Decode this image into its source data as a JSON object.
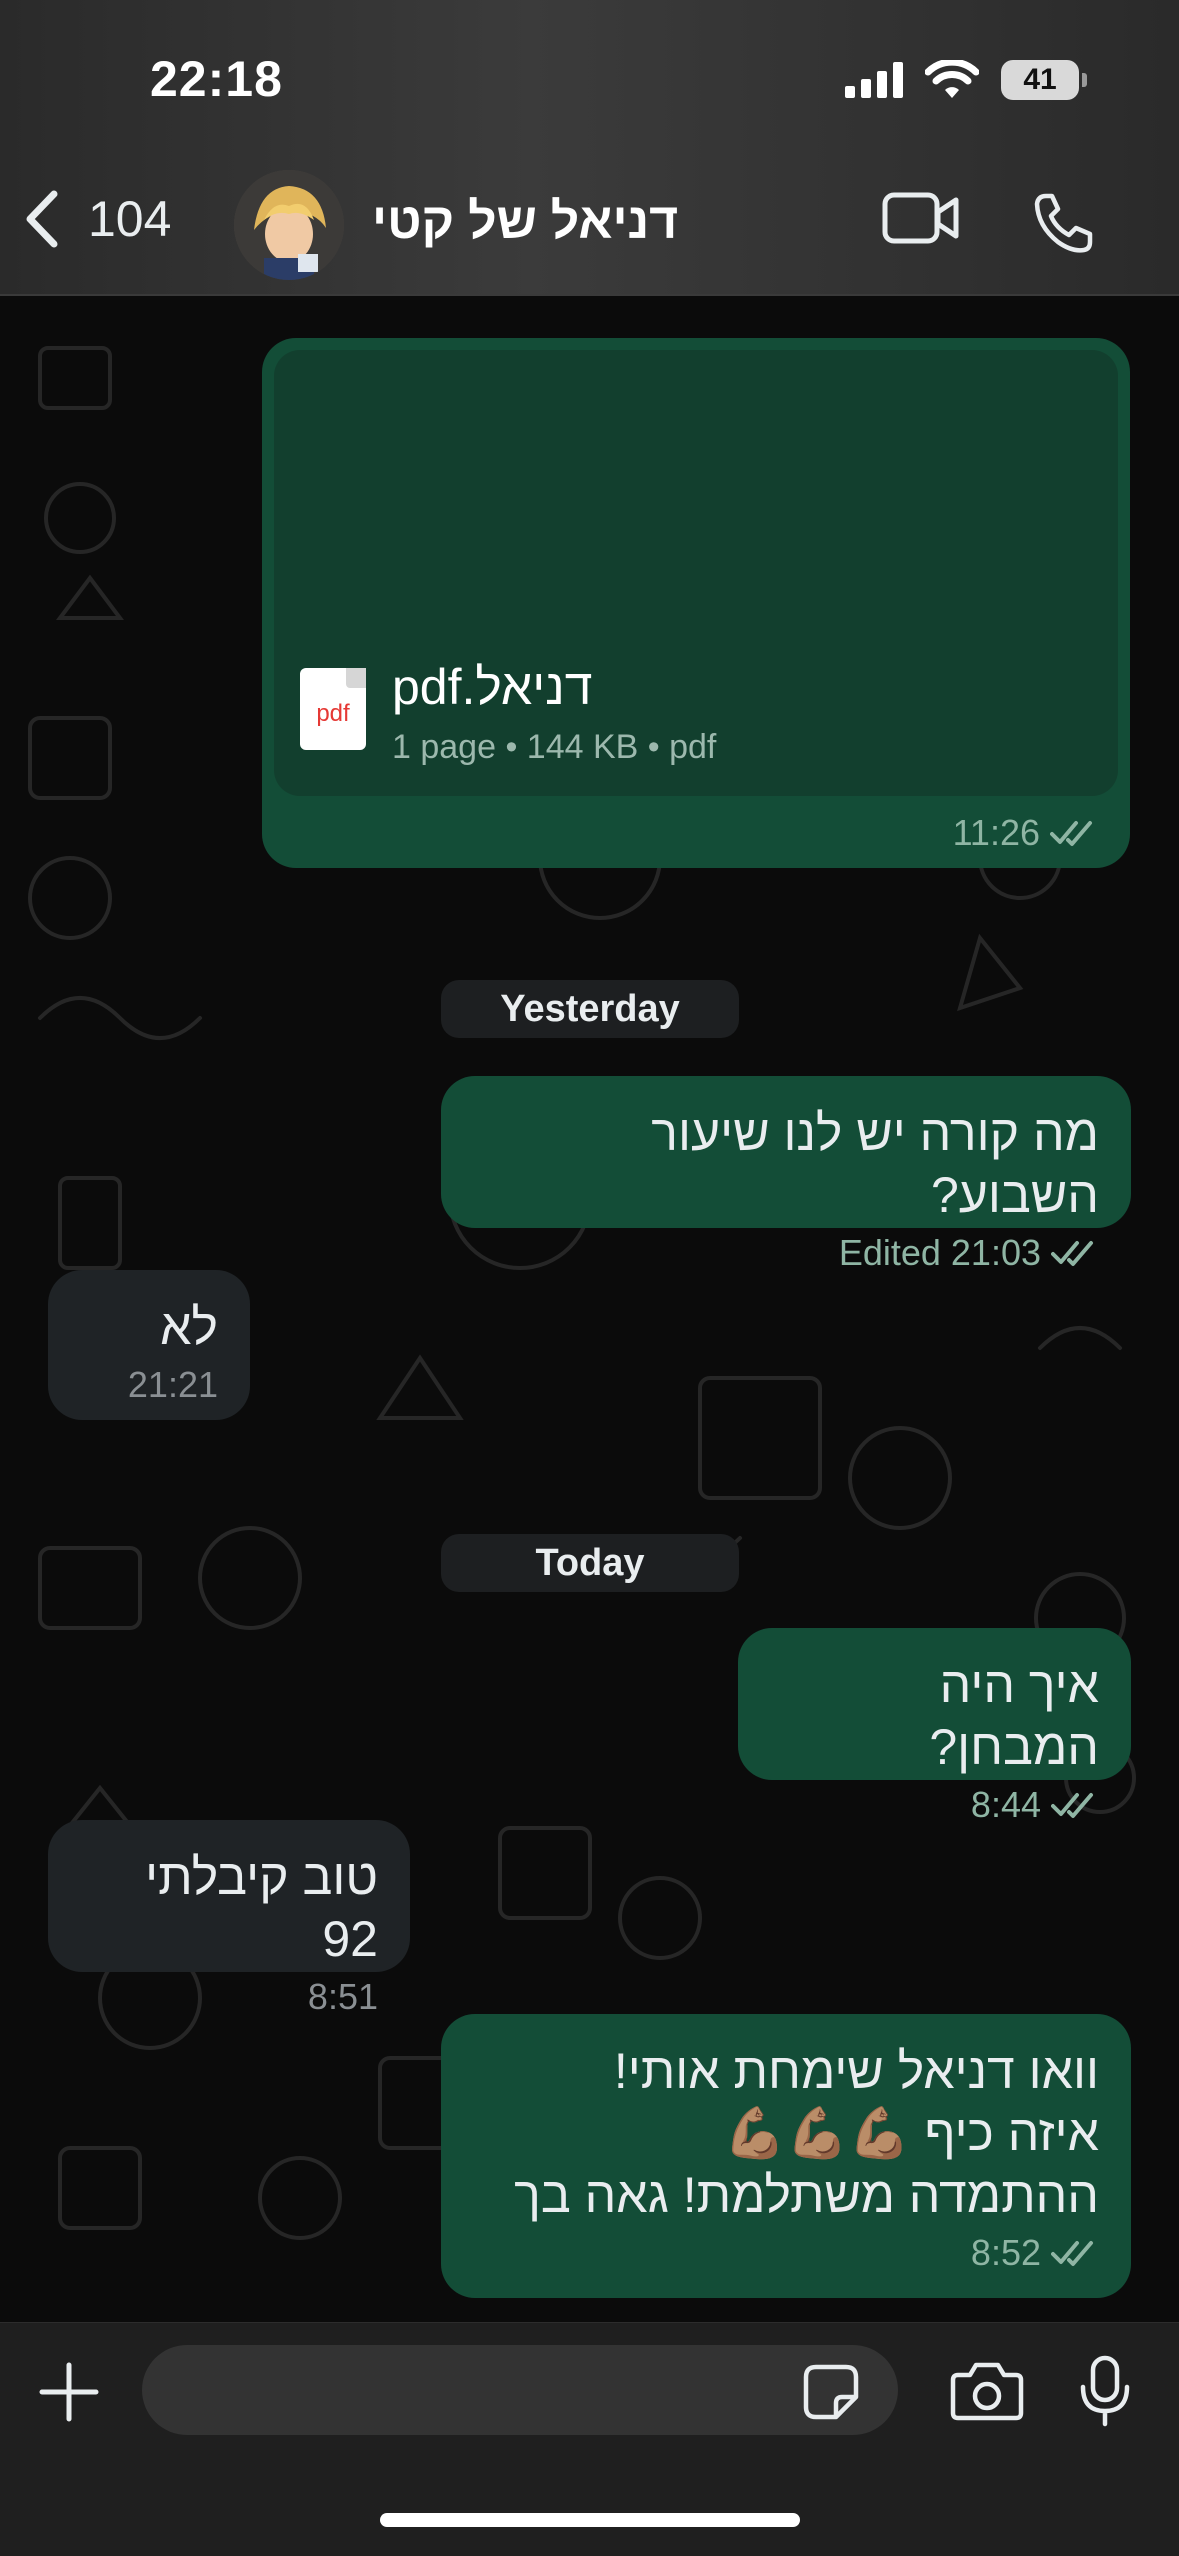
{
  "status_bar": {
    "time": "22:18",
    "battery": "41",
    "icons": [
      "cellular-signal-icon",
      "wifi-icon",
      "battery-icon"
    ]
  },
  "header": {
    "back_count": "104",
    "contact_name": "דניאל של קטי",
    "icons": [
      "chevron-left-icon",
      "video-call-icon",
      "phone-icon"
    ]
  },
  "messages": {
    "pdf": {
      "file_name": "pdf.דניאל",
      "file_badge": "pdf",
      "info": "1 page • 144 KB • pdf",
      "time": "11:26"
    },
    "date_yesterday": "Yesterday",
    "m1": {
      "text": "מה קורה יש לנו שיעור השבוע?",
      "edited": "Edited",
      "time": "21:03"
    },
    "m2": {
      "text": "לא",
      "time": "21:21"
    },
    "date_today": "Today",
    "m3": {
      "text": "איך היה המבחן?",
      "time": "8:44"
    },
    "m4": {
      "text": "טוב קיבלתי 92",
      "time": "8:51"
    },
    "m5": {
      "line1": "וואו דניאל שימחת אותי!",
      "line2": "איזה כיף 💪🏽💪🏽💪🏽",
      "line3": "ההתמדה משתלמת! גאה בך",
      "time": "8:52"
    }
  },
  "input_bar": {
    "placeholder": "",
    "icons": [
      "plus-icon",
      "sticker-icon",
      "camera-icon",
      "microphone-icon"
    ]
  },
  "colors": {
    "outgoing_bubble": "#134d37",
    "incoming_bubble": "#1f2326",
    "read_ticks": "#8fb5a4"
  }
}
